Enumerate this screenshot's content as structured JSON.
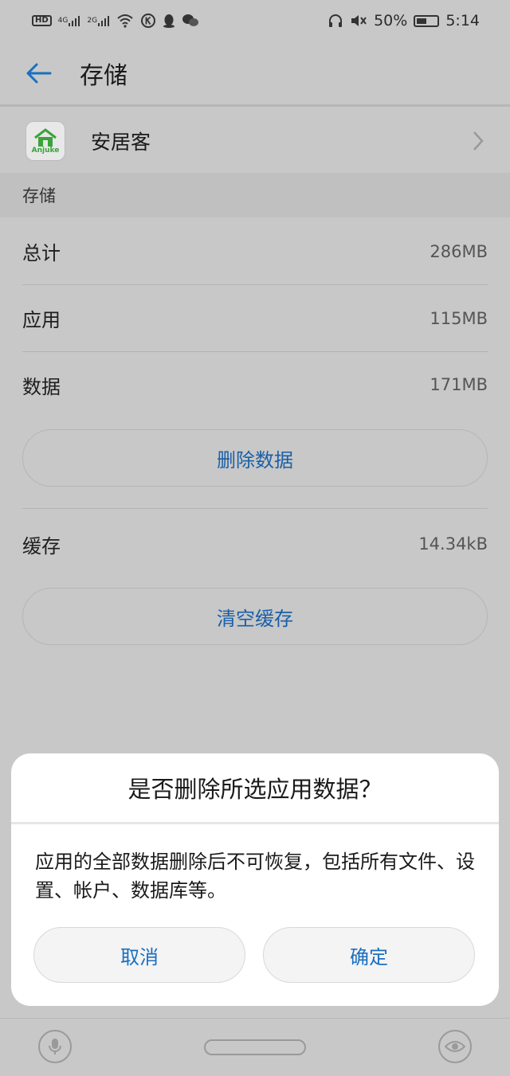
{
  "status_bar": {
    "hd": "HD",
    "net1": "4G",
    "net2": "2G",
    "battery_percent": "50%",
    "time": "5:14"
  },
  "header": {
    "title": "存储"
  },
  "app": {
    "name": "安居客",
    "icon_label": "Anjuke"
  },
  "storage": {
    "section_title": "存储",
    "rows": [
      {
        "label": "总计",
        "value": "286MB"
      },
      {
        "label": "应用",
        "value": "115MB"
      },
      {
        "label": "数据",
        "value": "171MB"
      }
    ],
    "delete_data_label": "删除数据",
    "cache_label": "缓存",
    "cache_value": "14.34kB",
    "clear_cache_label": "清空缓存"
  },
  "dialog": {
    "title": "是否删除所选应用数据？",
    "message": "应用的全部数据删除后不可恢复，包括所有文件、设置、帐户、数据库等。",
    "cancel_label": "取消",
    "confirm_label": "确定"
  },
  "colors": {
    "accent": "#1a6fc0",
    "overlay_bg": "#c8c8c8",
    "dialog_bg": "#ffffff"
  }
}
